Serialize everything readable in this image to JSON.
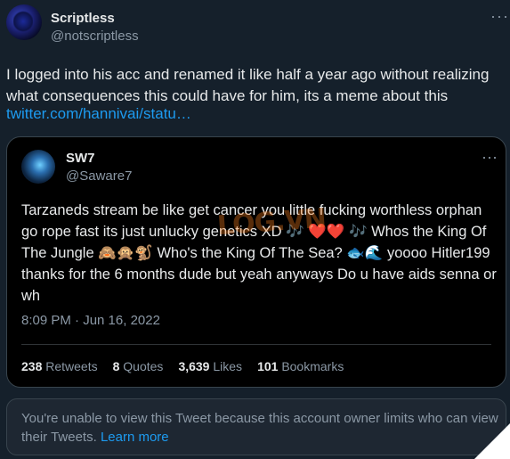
{
  "tweet": {
    "display_name": "Scriptless",
    "handle": "@notscriptless",
    "more": "···",
    "text": "I logged into his acc and renamed it like half a year ago without realizing what consequences this could have for him, its a meme about this",
    "link": "twitter.com/hannivai/statu…"
  },
  "quote": {
    "display_name": "SW7",
    "handle": "@Saware7",
    "more": "···",
    "text": "Tarzaneds stream be like get cancer you little fucking worthless orphan go rope fast its just unlucky genetics XD 🎶 ❤️❤️ 🎶 Whos the King Of The Jungle 🙈🙊🐒 Who's the King Of The Sea? 🐟🌊 yoooo Hitler199 thanks for the 6 months dude but yeah anyways Do u have aids senna or wh",
    "watermark": "LOG.VN",
    "timestamp": "8:09 PM · Jun 16, 2022",
    "stats": {
      "retweets_count": "238",
      "retweets_label": "Retweets",
      "quotes_count": "8",
      "quotes_label": "Quotes",
      "likes_count": "3,639",
      "likes_label": "Likes",
      "bookmarks_count": "101",
      "bookmarks_label": "Bookmarks"
    }
  },
  "notice": {
    "text": "You're unable to view this Tweet because this account owner limits who can view their Tweets.",
    "link": "Learn more"
  },
  "colors": {
    "background": "#15202b",
    "accent": "#1d9bf0",
    "muted": "#8b98a5"
  }
}
